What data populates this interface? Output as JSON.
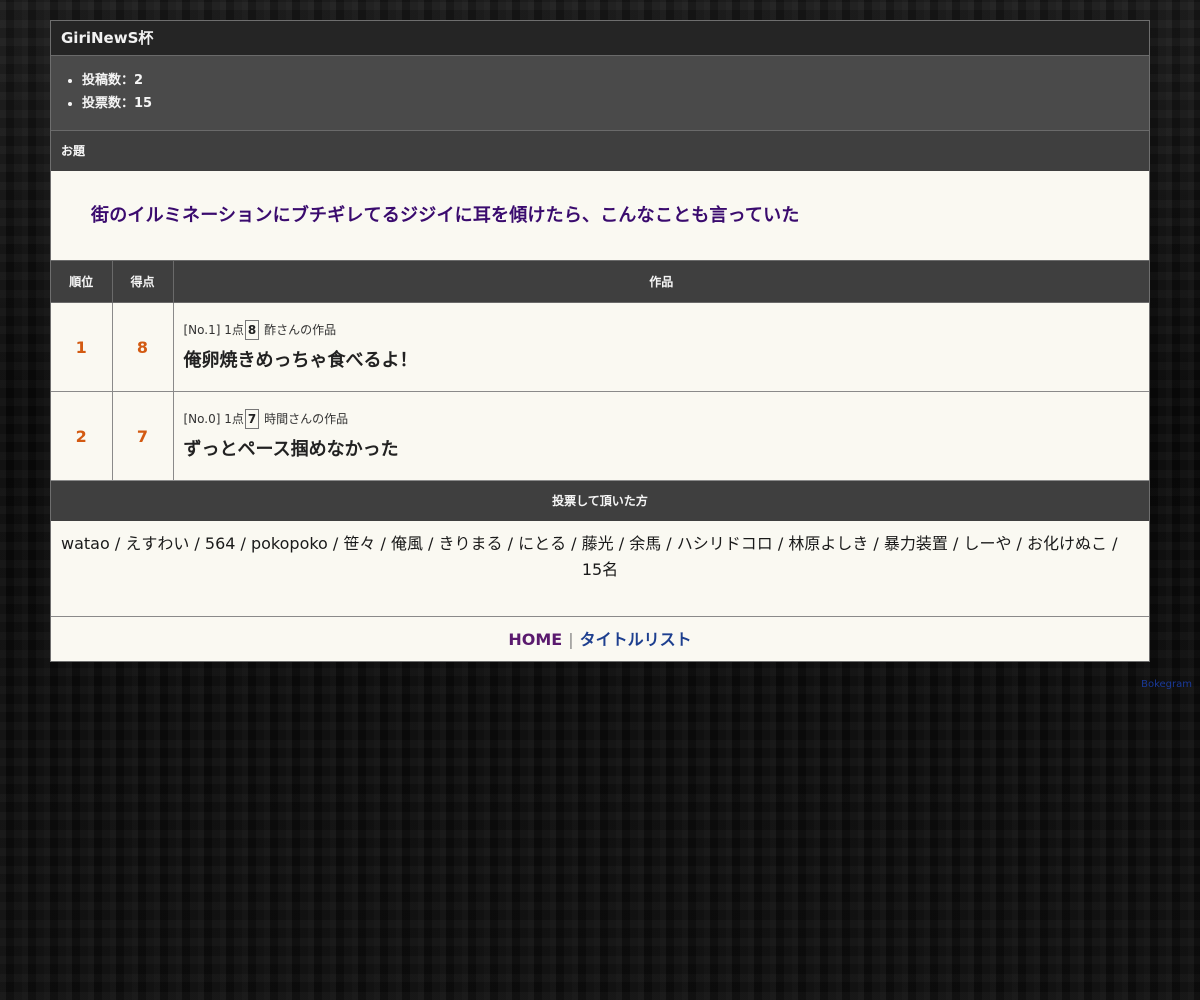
{
  "page": {
    "title": "GiriNewS杯"
  },
  "stats": [
    "投稿数：2",
    "投票数：15"
  ],
  "odai": {
    "label": "お題",
    "text": "街のイルミネーションにブチギレてるジジイに耳を傾けたら、こんなことも言っていた"
  },
  "results": {
    "headers": {
      "rank": "順位",
      "score": "得点",
      "work": "作品"
    },
    "rows": [
      {
        "rank": "1",
        "score": "8",
        "no": "[No.1]",
        "pt_label": "1点",
        "pt_value": "8",
        "author": "酢さんの作品",
        "title": "俺卵焼きめっちゃ食べるよ！"
      },
      {
        "rank": "2",
        "score": "7",
        "no": "[No.0]",
        "pt_label": "1点",
        "pt_value": "7",
        "author": "時間さんの作品",
        "title": "ずっとペース掴めなかった"
      }
    ]
  },
  "voters": {
    "label": "投票して頂いた方",
    "list": "watao / えすわい / 564 / pokopoko / 笹々 / 俺風 / きりまる / にとる / 藤光 / 余馬 / ハシリドコロ / 林原よしき / 暴力装置 / しーや / お化けぬこ /",
    "count": "15名"
  },
  "footer": {
    "home": "HOME",
    "separator": "|",
    "title_list": "タイトルリスト"
  },
  "credit": "Bokegram",
  "colors": {
    "score": "#d35a12",
    "odai_text": "#3a0b6e",
    "home_link": "#5a1a6e",
    "list_link": "#1d3f8f"
  }
}
